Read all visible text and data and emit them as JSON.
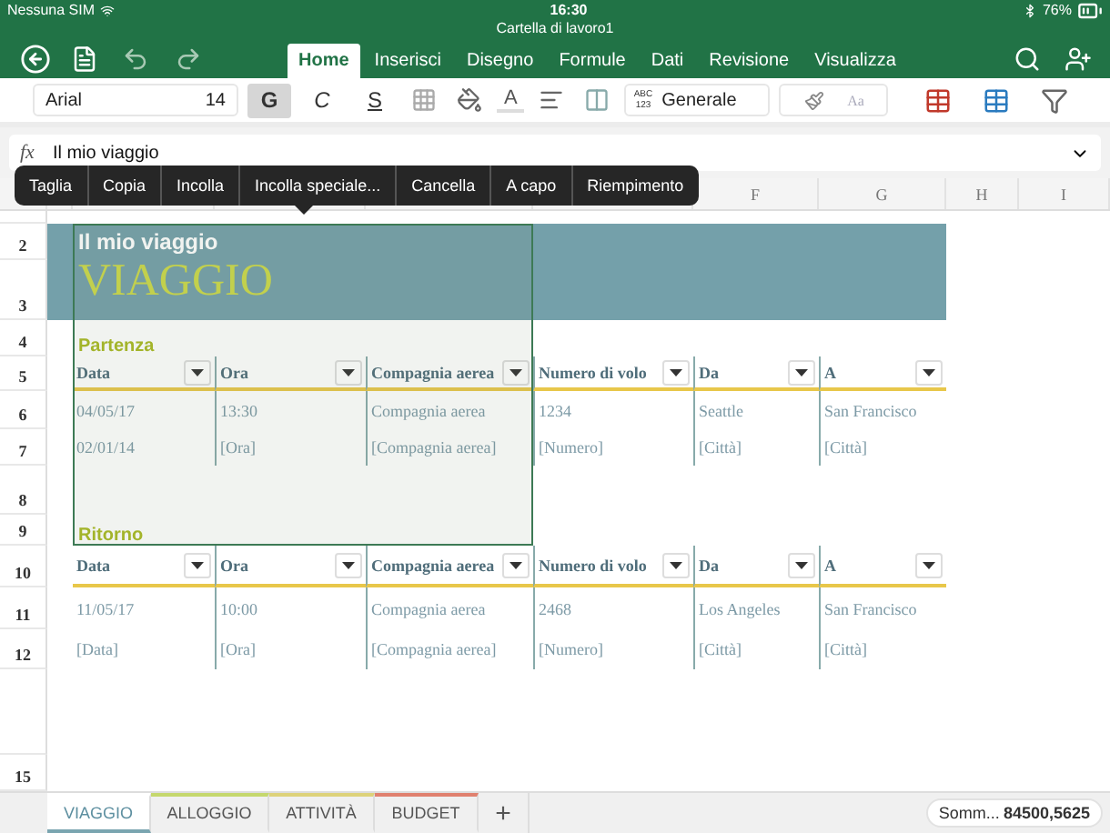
{
  "status_bar": {
    "carrier": "Nessuna SIM",
    "time": "16:30",
    "battery": "76%"
  },
  "document_title": "Cartella di lavoro1",
  "ribbon_tabs": [
    {
      "label": "Home",
      "selected": true
    },
    {
      "label": "Inserisci",
      "selected": false
    },
    {
      "label": "Disegno",
      "selected": false
    },
    {
      "label": "Formule",
      "selected": false
    },
    {
      "label": "Dati",
      "selected": false
    },
    {
      "label": "Revisione",
      "selected": false
    },
    {
      "label": "Visualizza",
      "selected": false
    }
  ],
  "ribbon": {
    "font_name": "Arial",
    "font_size": "14",
    "format_buttons": [
      {
        "kind": "bold",
        "label": "G",
        "on": true
      },
      {
        "kind": "italic",
        "label": "C",
        "on": false
      },
      {
        "kind": "underline",
        "label": "S",
        "on": false
      }
    ],
    "font_color_label": "A",
    "number_format_icon": [
      "ABC",
      "123"
    ],
    "number_format": "Generale",
    "style_preview": "Aa"
  },
  "formula_bar": {
    "label": "fx",
    "value": "Il mio viaggio"
  },
  "context_menu": [
    "Taglia",
    "Copia",
    "Incolla",
    "Incolla speciale...",
    "Cancella",
    "A capo",
    "Riempimento"
  ],
  "column_headers": [
    "F",
    "G",
    "H",
    "I"
  ],
  "row_numbers": [
    "2",
    "3",
    "4",
    "5",
    "6",
    "7",
    "8",
    "9",
    "10",
    "11",
    "12",
    "15"
  ],
  "banner": {
    "subtitle": "Il mio viaggio",
    "title": "VIAGGIO"
  },
  "sections": [
    {
      "label": "Partenza",
      "columns": [
        "Data",
        "Ora",
        "Compagnia aerea",
        "Numero di volo",
        "Da",
        "A"
      ],
      "rows": [
        [
          "04/05/17",
          "13:30",
          "Compagnia aerea",
          "1234",
          "Seattle",
          "San Francisco"
        ],
        [
          "02/01/14",
          "[Ora]",
          "[Compagnia aerea]",
          "[Numero]",
          "[Città]",
          "[Città]"
        ]
      ]
    },
    {
      "label": "Ritorno",
      "columns": [
        "Data",
        "Ora",
        "Compagnia aerea",
        "Numero di volo",
        "Da",
        "A"
      ],
      "rows": [
        [
          "11/05/17",
          "10:00",
          "Compagnia aerea",
          "2468",
          "Los Angeles",
          "San Francisco"
        ],
        [
          "[Data]",
          "[Ora]",
          "[Compagnia aerea]",
          "[Numero]",
          "[Città]",
          "[Città]"
        ]
      ]
    }
  ],
  "sheet_tabs": [
    {
      "label": "VIAGGIO",
      "selected": true,
      "color": "#7aa5b0"
    },
    {
      "label": "ALLOGGIO",
      "selected": false,
      "color": "#c5d86d"
    },
    {
      "label": "ATTIVITÀ",
      "selected": false,
      "color": "#ddd27a"
    },
    {
      "label": "BUDGET",
      "selected": false,
      "color": "#e0816f"
    }
  ],
  "add_sheet": "+",
  "sum": {
    "label": "Somm...",
    "value": "84500,5625"
  }
}
